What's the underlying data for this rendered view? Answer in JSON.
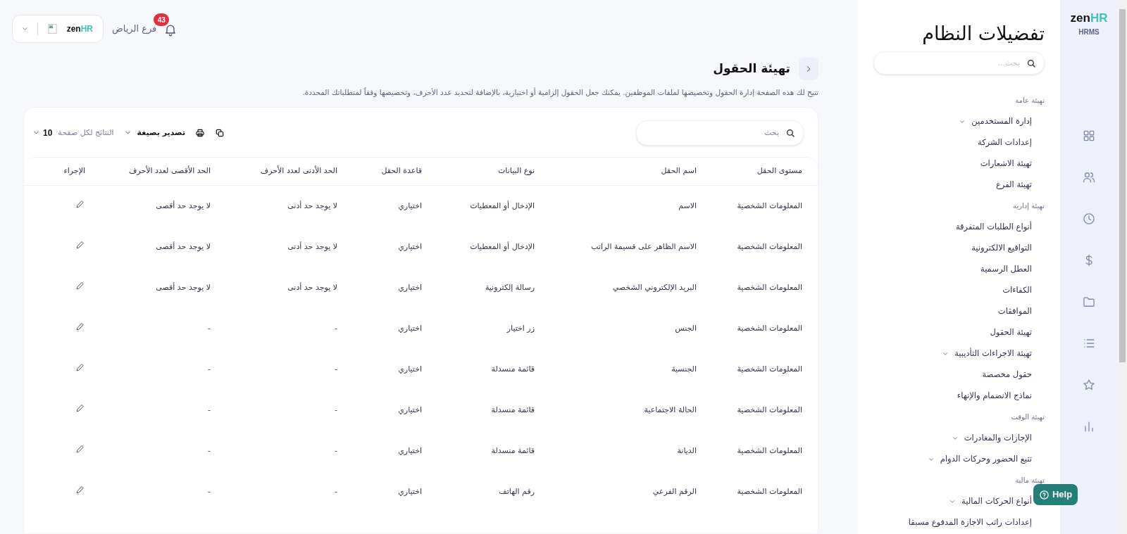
{
  "header": {
    "notifications": {
      "count": "43"
    },
    "branch": "فرع الرياض",
    "logo": {
      "word": "zen",
      "accent": "HR"
    }
  },
  "page": {
    "title": "تهيئة الحقول",
    "description": "تتيح لك هذه الصفحة إدارة الحقول وتخصيصها لملفات الموظفين. يمكنك جعل الحقول إلزامية أو اختيارية، بالإضافة لتحديد عدد الأحرف، وتخصيصها وفقاً لمتطلباتك المحددة."
  },
  "toolbar": {
    "search": {
      "placeholder": "بحث"
    },
    "export": "تصدير بصيغة",
    "page_size_label": "النتائج لكل صفحة",
    "page_size": "10"
  },
  "table": {
    "columns": [
      "مستوى الحقل",
      "اسم الحقل",
      "نوع البيانات",
      "قاعدة الحقل",
      "الحد الأدنى لعدد الأحرف",
      "الحد الأقصى لعدد الأحرف",
      "الإجراء"
    ],
    "rows": [
      [
        "المعلومات الشخصية",
        "الاسم",
        "الإدخال أو المعطيات",
        "اختياري",
        "لا يوجد حد أدنى",
        "لا يوجد حد أقصى"
      ],
      [
        "المعلومات الشخصية",
        "الاسم الظاهر على قسيمة الراتب",
        "الإدخال أو المعطيات",
        "اختياري",
        "لا يوجد حد أدنى",
        "لا يوجد حد أقصى"
      ],
      [
        "المعلومات الشخصية",
        "البريد الإلكتروني الشخصي",
        "رسالة إلكترونية",
        "اختياري",
        "لا يوجد حد أدنى",
        "لا يوجد حد أقصى"
      ],
      [
        "المعلومات الشخصية",
        "الجنس",
        "زر اختيار",
        "اختياري",
        "-",
        "-"
      ],
      [
        "المعلومات الشخصية",
        "الجنسية",
        "قائمة منسدلة",
        "اختياري",
        "-",
        "-"
      ],
      [
        "المعلومات الشخصية",
        "الحالة الاجتماعية",
        "قائمة منسدلة",
        "اختياري",
        "-",
        "-"
      ],
      [
        "المعلومات الشخصية",
        "الديانة",
        "قائمة منسدلة",
        "اختياري",
        "-",
        "-"
      ],
      [
        "المعلومات الشخصية",
        "الرقم الفرعي",
        "رقم الهاتف",
        "اختياري",
        "-",
        "-"
      ]
    ]
  },
  "sidebar": {
    "title": "تفضيلات النظام",
    "search": {
      "placeholder": "بحث..."
    },
    "items": [
      {
        "kind": "heading",
        "label": "تهيئة عامة"
      },
      {
        "kind": "link",
        "label": "إدارة المستخدمين",
        "expandable": true
      },
      {
        "kind": "link",
        "label": "إعدادات الشركة",
        "expandable": false
      },
      {
        "kind": "link",
        "label": "تهيئة الاشعارات",
        "expandable": false
      },
      {
        "kind": "link",
        "label": "تهيئة الفرع",
        "expandable": false
      },
      {
        "kind": "heading",
        "label": "تهيئة إدارية"
      },
      {
        "kind": "link",
        "label": "أنواع الطلبات المتفرقة",
        "expandable": false
      },
      {
        "kind": "link",
        "label": "التواقيع الالكترونية",
        "expandable": false
      },
      {
        "kind": "link",
        "label": "العطل الرسمية",
        "expandable": false
      },
      {
        "kind": "link",
        "label": "الكفاءات",
        "expandable": false
      },
      {
        "kind": "link",
        "label": "الموافقات",
        "expandable": false
      },
      {
        "kind": "link",
        "label": "تهيئة الحقول",
        "expandable": false
      },
      {
        "kind": "link",
        "label": "تهيئة الاجراءات التأديبية",
        "expandable": true
      },
      {
        "kind": "link",
        "label": "حقول مخصصة",
        "expandable": false
      },
      {
        "kind": "link",
        "label": "نماذج الانضمام والإنهاء",
        "expandable": false
      },
      {
        "kind": "heading",
        "label": "تهيئة الوقت"
      },
      {
        "kind": "link",
        "label": "الإجازات والمغادرات",
        "expandable": true
      },
      {
        "kind": "link",
        "label": "تتبع الحضور وحركات الدوام",
        "expandable": true
      },
      {
        "kind": "heading",
        "label": "تهيئة مالية"
      },
      {
        "kind": "link",
        "label": "أنواع الحركات المالية",
        "expandable": true
      },
      {
        "kind": "link",
        "label": "إعدادات راتب الاجازة المدفوع مسبقا",
        "expandable": false
      }
    ]
  },
  "rail": {
    "logo": {
      "word": "zen",
      "accent": "HR"
    },
    "product": "HRMS"
  },
  "help": {
    "label": "Help"
  }
}
